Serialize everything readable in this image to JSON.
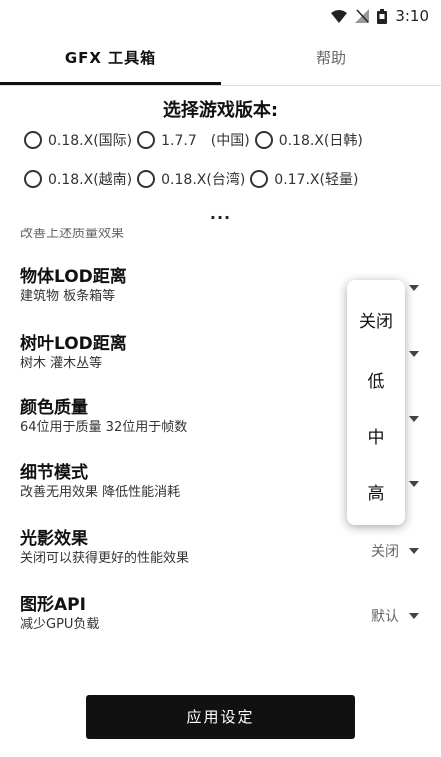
{
  "status_bar": {
    "time": "3:10"
  },
  "tabs": [
    {
      "label": "GFX 工具箱"
    },
    {
      "label": "帮助"
    }
  ],
  "version": {
    "title": "选择游戏版本:",
    "options_row1": [
      "0.18.X(国际)",
      "1.7.7　(中国)",
      "0.18.X(日韩)"
    ],
    "options_row2": [
      "0.18.X(越南)",
      "0.18.X(台湾)",
      "0.17.X(轻量)"
    ],
    "more": "..."
  },
  "clipped_text": "改善上述质量效果",
  "settings": [
    {
      "title": "物体LOD距离",
      "desc": "建筑物 板条箱等",
      "value": ""
    },
    {
      "title": "树叶LOD距离",
      "desc": "树木 灌木丛等",
      "value": ""
    },
    {
      "title": "颜色质量",
      "desc": "64位用于质量 32位用于帧数",
      "value": ""
    },
    {
      "title": "细节模式",
      "desc": "改善无用效果 降低性能消耗",
      "value": ""
    },
    {
      "title": "光影效果",
      "desc": "关闭可以获得更好的性能效果",
      "value": "关闭"
    },
    {
      "title": "图形API",
      "desc": "减少GPU负载",
      "value": "默认"
    }
  ],
  "popup_options": [
    "关闭",
    "低",
    "中",
    "高"
  ],
  "apply_button": "应用设定"
}
